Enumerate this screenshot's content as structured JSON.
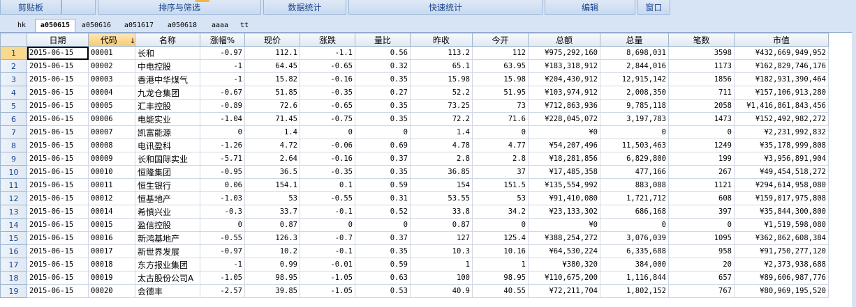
{
  "ribbon": {
    "groups": [
      "剪贴板",
      "",
      "排序与筛选",
      "数据统计",
      "快速统计",
      "编辑",
      "窗口"
    ]
  },
  "tabs": [
    "hk",
    "a050615",
    "a050616",
    "a051617",
    "a050618",
    "aaaa",
    "tt"
  ],
  "active_tab": "a050615",
  "grid": {
    "columns": [
      "日期",
      "代码",
      "名称",
      "涨幅%",
      "现价",
      "涨跌",
      "量比",
      "昨收",
      "今开",
      "总额",
      "总量",
      "笔数",
      "市值"
    ],
    "sorted_column_indicator": "↓",
    "rows": [
      [
        "2015-06-15",
        "00001",
        "长和",
        "-0.97",
        "112.1",
        "-1.1",
        "0.56",
        "113.2",
        "112",
        "¥975,292,160",
        "8,698,031",
        "3598",
        "¥432,669,949,952"
      ],
      [
        "2015-06-15",
        "00002",
        "中电控股",
        "-1",
        "64.45",
        "-0.65",
        "0.32",
        "65.1",
        "63.95",
        "¥183,318,912",
        "2,844,016",
        "1173",
        "¥162,829,746,176"
      ],
      [
        "2015-06-15",
        "00003",
        "香港中华煤气",
        "-1",
        "15.82",
        "-0.16",
        "0.35",
        "15.98",
        "15.98",
        "¥204,430,912",
        "12,915,142",
        "1856",
        "¥182,931,390,464"
      ],
      [
        "2015-06-15",
        "00004",
        "九龙仓集团",
        "-0.67",
        "51.85",
        "-0.35",
        "0.27",
        "52.2",
        "51.95",
        "¥103,974,912",
        "2,008,350",
        "711",
        "¥157,106,913,280"
      ],
      [
        "2015-06-15",
        "00005",
        "汇丰控股",
        "-0.89",
        "72.6",
        "-0.65",
        "0.35",
        "73.25",
        "73",
        "¥712,863,936",
        "9,785,118",
        "2058",
        "¥1,416,861,843,456"
      ],
      [
        "2015-06-15",
        "00006",
        "电能实业",
        "-1.04",
        "71.45",
        "-0.75",
        "0.35",
        "72.2",
        "71.6",
        "¥228,045,072",
        "3,197,783",
        "1473",
        "¥152,492,982,272"
      ],
      [
        "2015-06-15",
        "00007",
        "凯富能源",
        "0",
        "1.4",
        "0",
        "0",
        "1.4",
        "0",
        "¥0",
        "0",
        "0",
        "¥2,231,992,832"
      ],
      [
        "2015-06-15",
        "00008",
        "电讯盈科",
        "-1.26",
        "4.72",
        "-0.06",
        "0.69",
        "4.78",
        "4.77",
        "¥54,207,496",
        "11,503,463",
        "1249",
        "¥35,178,999,808"
      ],
      [
        "2015-06-15",
        "00009",
        "长和国际实业",
        "-5.71",
        "2.64",
        "-0.16",
        "0.37",
        "2.8",
        "2.8",
        "¥18,281,856",
        "6,829,800",
        "199",
        "¥3,956,891,904"
      ],
      [
        "2015-06-15",
        "00010",
        "恒隆集团",
        "-0.95",
        "36.5",
        "-0.35",
        "0.35",
        "36.85",
        "37",
        "¥17,485,358",
        "477,166",
        "267",
        "¥49,454,518,272"
      ],
      [
        "2015-06-15",
        "00011",
        "恒生银行",
        "0.06",
        "154.1",
        "0.1",
        "0.59",
        "154",
        "151.5",
        "¥135,554,992",
        "883,088",
        "1121",
        "¥294,614,958,080"
      ],
      [
        "2015-06-15",
        "00012",
        "恒基地产",
        "-1.03",
        "53",
        "-0.55",
        "0.31",
        "53.55",
        "53",
        "¥91,410,080",
        "1,721,712",
        "608",
        "¥159,017,975,808"
      ],
      [
        "2015-06-15",
        "00014",
        "希慎兴业",
        "-0.3",
        "33.7",
        "-0.1",
        "0.52",
        "33.8",
        "34.2",
        "¥23,133,302",
        "686,168",
        "397",
        "¥35,844,300,800"
      ],
      [
        "2015-06-15",
        "00015",
        "盈信控股",
        "0",
        "0.87",
        "0",
        "0",
        "0.87",
        "0",
        "¥0",
        "0",
        "0",
        "¥1,519,598,080"
      ],
      [
        "2015-06-15",
        "00016",
        "新鸿基地产",
        "-0.55",
        "126.3",
        "-0.7",
        "0.37",
        "127",
        "125.4",
        "¥388,254,272",
        "3,076,039",
        "1095",
        "¥362,862,608,384"
      ],
      [
        "2015-06-15",
        "00017",
        "新世界发展",
        "-0.97",
        "10.2",
        "-0.1",
        "0.35",
        "10.3",
        "10.16",
        "¥64,530,224",
        "6,335,688",
        "958",
        "¥91,750,277,120"
      ],
      [
        "2015-06-15",
        "00018",
        "东方报业集团",
        "-1",
        "0.99",
        "-0.01",
        "0.59",
        "1",
        "1",
        "¥380,320",
        "384,000",
        "20",
        "¥2,373,938,688"
      ],
      [
        "2015-06-15",
        "00019",
        "太古股份公司A",
        "-1.05",
        "98.95",
        "-1.05",
        "0.63",
        "100",
        "98.95",
        "¥110,675,200",
        "1,116,844",
        "657",
        "¥89,606,987,776"
      ],
      [
        "2015-06-15",
        "00020",
        "会德丰",
        "-2.57",
        "39.85",
        "-1.05",
        "0.53",
        "40.9",
        "40.55",
        "¥72,211,704",
        "1,802,152",
        "767",
        "¥80,969,195,520"
      ]
    ]
  }
}
